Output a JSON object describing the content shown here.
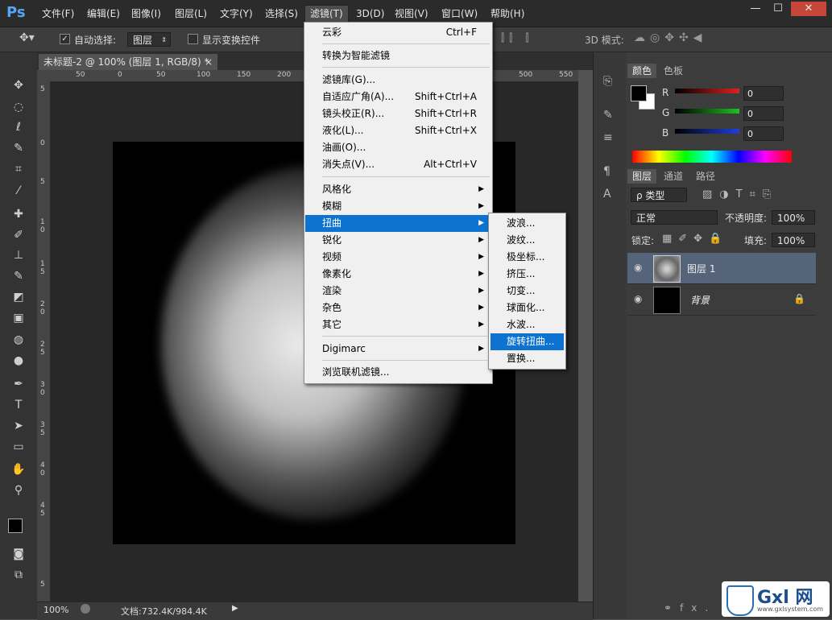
{
  "app": {
    "logo": "Ps"
  },
  "menubar": [
    "文件(F)",
    "编辑(E)",
    "图像(I)",
    "图层(L)",
    "文字(Y)",
    "选择(S)",
    "滤镜(T)",
    "3D(D)",
    "视图(V)",
    "窗口(W)",
    "帮助(H)"
  ],
  "window_buttons": {
    "minimize": "—",
    "maximize": "☐",
    "close": "✕"
  },
  "options_bar": {
    "auto_select_label": "自动选择:",
    "auto_select_value": "图层",
    "show_transform_label": "显示变换控件",
    "mode_3d_label": "3D 模式:"
  },
  "document_tab": {
    "title": "未标题-2 @ 100% (图层 1, RGB/8) *",
    "close": "×"
  },
  "ruler_h_labels": [
    "50",
    "0",
    "50",
    "100",
    "150",
    "200",
    "500",
    "550"
  ],
  "ruler_v_labels": [
    "5",
    "0",
    "5",
    "1 0",
    "1 5",
    "2 0",
    "2 5",
    "3 0",
    "3 5",
    "4 0",
    "4 5",
    "5"
  ],
  "status_bar": {
    "zoom": "100%",
    "doc": "文档:732.4K/984.4K"
  },
  "color_panel": {
    "tabs": [
      "颜色",
      "色板"
    ],
    "channels": [
      {
        "label": "R",
        "value": "0",
        "color": "#e02020"
      },
      {
        "label": "G",
        "value": "0",
        "color": "#20c020"
      },
      {
        "label": "B",
        "value": "0",
        "color": "#2040e0"
      }
    ]
  },
  "layers_panel": {
    "tabs": [
      "图层",
      "通道",
      "路径"
    ],
    "filter_label": "ρ 类型",
    "blend_mode": "正常",
    "opacity_label": "不透明度:",
    "opacity_value": "100%",
    "lock_label": "锁定:",
    "fill_label": "填充:",
    "fill_value": "100%",
    "layers": [
      {
        "name": "图层 1",
        "selected": true
      },
      {
        "name": "背景",
        "selected": false
      }
    ],
    "footer": "fx."
  },
  "filter_menu": {
    "items": [
      {
        "label": "云彩",
        "shortcut": "Ctrl+F"
      },
      {
        "label": "转换为智能滤镜"
      },
      {
        "label": "滤镜库(G)..."
      },
      {
        "label": "自适应广角(A)...",
        "shortcut": "Shift+Ctrl+A"
      },
      {
        "label": "镜头校正(R)...",
        "shortcut": "Shift+Ctrl+R"
      },
      {
        "label": "液化(L)...",
        "shortcut": "Shift+Ctrl+X"
      },
      {
        "label": "油画(O)..."
      },
      {
        "label": "消失点(V)...",
        "shortcut": "Alt+Ctrl+V"
      },
      {
        "label": "风格化"
      },
      {
        "label": "模糊"
      },
      {
        "label": "扭曲"
      },
      {
        "label": "锐化"
      },
      {
        "label": "视频"
      },
      {
        "label": "像素化"
      },
      {
        "label": "渲染"
      },
      {
        "label": "杂色"
      },
      {
        "label": "其它"
      },
      {
        "label": "Digimarc"
      },
      {
        "label": "浏览联机滤镜..."
      }
    ]
  },
  "distort_submenu": [
    "波浪...",
    "波纹...",
    "极坐标...",
    "挤压...",
    "切变...",
    "球面化...",
    "水波...",
    "旋转扭曲...",
    "置换..."
  ],
  "watermark": {
    "brand": "Gxl 网",
    "url": "www.gxlsystem.com"
  }
}
